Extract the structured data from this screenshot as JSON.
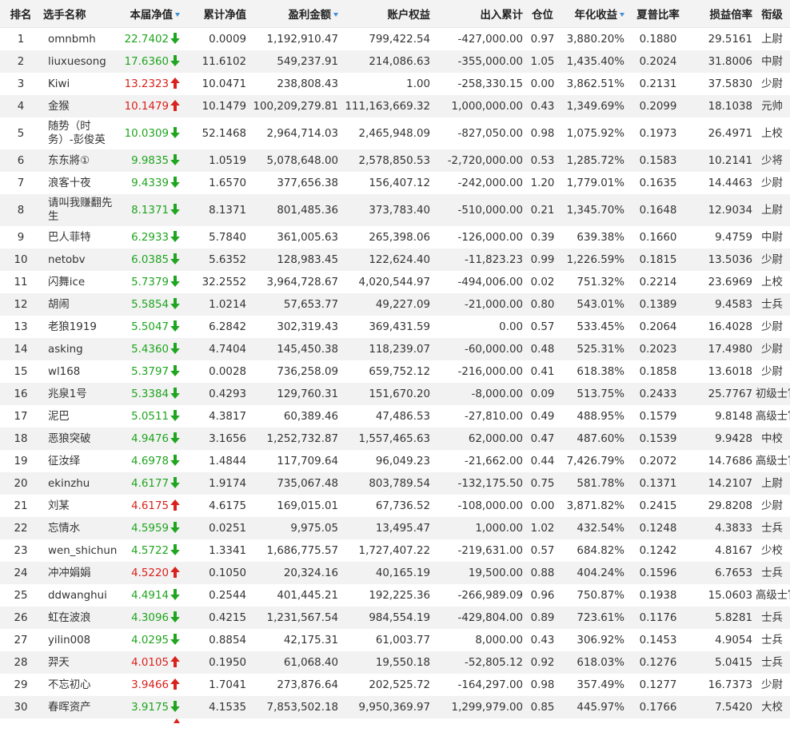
{
  "columns": {
    "rank": "排名",
    "name": "选手名称",
    "week_nav": "本届净值",
    "cum_nav": "累计净值",
    "profit": "盈利金额",
    "equity": "账户权益",
    "inout": "出入累计",
    "position": "仓位",
    "annual": "年化收益",
    "sharpe": "夏普比率",
    "pl_ratio": "损益倍率",
    "title": "衔级"
  },
  "colors": {
    "up": "#d9221c",
    "down": "#1fa51f",
    "sort_indicator": "#3d8fd6",
    "alt_row": "#f2f2f2"
  },
  "rows": [
    {
      "rank": "1",
      "name": "omnbmh",
      "nav": "22.7402",
      "trend": "down",
      "cum": "0.0009",
      "profit": "1,192,910.47",
      "equity": "799,422.54",
      "inout": "-427,000.00",
      "pos": "0.97",
      "annual": "3,880.20%",
      "sharpe": "0.1880",
      "pl": "29.5161",
      "title": "上尉"
    },
    {
      "rank": "2",
      "name": "liuxuesong",
      "nav": "17.6360",
      "trend": "down",
      "cum": "11.6102",
      "profit": "549,237.91",
      "equity": "214,086.63",
      "inout": "-355,000.00",
      "pos": "1.05",
      "annual": "1,435.40%",
      "sharpe": "0.2024",
      "pl": "31.8006",
      "title": "中尉"
    },
    {
      "rank": "3",
      "name": "Kiwi",
      "nav": "13.2323",
      "trend": "up",
      "cum": "10.0471",
      "profit": "238,808.43",
      "equity": "1.00",
      "inout": "-258,330.15",
      "pos": "0.00",
      "annual": "3,862.51%",
      "sharpe": "0.2131",
      "pl": "37.5830",
      "title": "少尉"
    },
    {
      "rank": "4",
      "name": "金猴",
      "nav": "10.1479",
      "trend": "up",
      "cum": "10.1479",
      "profit": "100,209,279.81",
      "equity": "111,163,669.32",
      "inout": "1,000,000.00",
      "pos": "0.43",
      "annual": "1,349.69%",
      "sharpe": "0.2099",
      "pl": "18.1038",
      "title": "元帅"
    },
    {
      "rank": "5",
      "name": "随势（时务）-彭俊英",
      "nav": "10.0309",
      "trend": "down",
      "cum": "52.1468",
      "profit": "2,964,714.03",
      "equity": "2,465,948.09",
      "inout": "-827,050.00",
      "pos": "0.98",
      "annual": "1,075.92%",
      "sharpe": "0.1973",
      "pl": "26.4971",
      "title": "上校",
      "tall": true
    },
    {
      "rank": "6",
      "name": "东东將①",
      "nav": "9.9835",
      "trend": "down",
      "cum": "1.0519",
      "profit": "5,078,648.00",
      "equity": "2,578,850.53",
      "inout": "-2,720,000.00",
      "pos": "0.53",
      "annual": "1,285.72%",
      "sharpe": "0.1583",
      "pl": "10.2141",
      "title": "少将"
    },
    {
      "rank": "7",
      "name": "浪客十夜",
      "nav": "9.4339",
      "trend": "down",
      "cum": "1.6570",
      "profit": "377,656.38",
      "equity": "156,407.12",
      "inout": "-242,000.00",
      "pos": "1.20",
      "annual": "1,779.01%",
      "sharpe": "0.1635",
      "pl": "14.4463",
      "title": "少尉"
    },
    {
      "rank": "8",
      "name": "请叫我赚翻先生",
      "nav": "8.1371",
      "trend": "down",
      "cum": "8.1371",
      "profit": "801,485.36",
      "equity": "373,783.40",
      "inout": "-510,000.00",
      "pos": "0.21",
      "annual": "1,345.70%",
      "sharpe": "0.1648",
      "pl": "12.9034",
      "title": "上尉",
      "tall": true
    },
    {
      "rank": "9",
      "name": "巴人菲特",
      "nav": "6.2933",
      "trend": "down",
      "cum": "5.7840",
      "profit": "361,005.63",
      "equity": "265,398.06",
      "inout": "-126,000.00",
      "pos": "0.39",
      "annual": "639.38%",
      "sharpe": "0.1660",
      "pl": "9.4759",
      "title": "中尉"
    },
    {
      "rank": "10",
      "name": "netobv",
      "nav": "6.0385",
      "trend": "down",
      "cum": "5.6352",
      "profit": "128,983.45",
      "equity": "122,624.40",
      "inout": "-11,823.23",
      "pos": "0.99",
      "annual": "1,226.59%",
      "sharpe": "0.1815",
      "pl": "13.5036",
      "title": "少尉"
    },
    {
      "rank": "11",
      "name": "闪舞ice",
      "nav": "5.7379",
      "trend": "down",
      "cum": "32.2552",
      "profit": "3,964,728.67",
      "equity": "4,020,544.97",
      "inout": "-494,006.00",
      "pos": "0.02",
      "annual": "751.32%",
      "sharpe": "0.2214",
      "pl": "23.6969",
      "title": "上校"
    },
    {
      "rank": "12",
      "name": "胡闹",
      "nav": "5.5854",
      "trend": "down",
      "cum": "1.0214",
      "profit": "57,653.77",
      "equity": "49,227.09",
      "inout": "-21,000.00",
      "pos": "0.80",
      "annual": "543.01%",
      "sharpe": "0.1389",
      "pl": "9.4583",
      "title": "士兵"
    },
    {
      "rank": "13",
      "name": "老狼1919",
      "nav": "5.5047",
      "trend": "down",
      "cum": "6.2842",
      "profit": "302,319.43",
      "equity": "369,431.59",
      "inout": "0.00",
      "pos": "0.57",
      "annual": "533.45%",
      "sharpe": "0.2064",
      "pl": "16.4028",
      "title": "少尉"
    },
    {
      "rank": "14",
      "name": "asking",
      "nav": "5.4360",
      "trend": "down",
      "cum": "4.7404",
      "profit": "145,450.38",
      "equity": "118,239.07",
      "inout": "-60,000.00",
      "pos": "0.48",
      "annual": "525.31%",
      "sharpe": "0.2023",
      "pl": "17.4980",
      "title": "少尉"
    },
    {
      "rank": "15",
      "name": "wl168",
      "nav": "5.3797",
      "trend": "down",
      "cum": "0.0028",
      "profit": "736,258.09",
      "equity": "659,752.12",
      "inout": "-216,000.00",
      "pos": "0.41",
      "annual": "618.38%",
      "sharpe": "0.1858",
      "pl": "13.6018",
      "title": "少尉"
    },
    {
      "rank": "16",
      "name": "兆泉1号",
      "nav": "5.3384",
      "trend": "down",
      "cum": "0.4293",
      "profit": "129,760.31",
      "equity": "151,670.20",
      "inout": "-8,000.00",
      "pos": "0.09",
      "annual": "513.75%",
      "sharpe": "0.2433",
      "pl": "25.7767",
      "title": "初级士官"
    },
    {
      "rank": "17",
      "name": "泥巴",
      "nav": "5.0511",
      "trend": "down",
      "cum": "4.3817",
      "profit": "60,389.46",
      "equity": "47,486.53",
      "inout": "-27,810.00",
      "pos": "0.49",
      "annual": "488.95%",
      "sharpe": "0.1579",
      "pl": "9.8148",
      "title": "高级士官"
    },
    {
      "rank": "18",
      "name": "恶狼突破",
      "nav": "4.9476",
      "trend": "down",
      "cum": "3.1656",
      "profit": "1,252,732.87",
      "equity": "1,557,465.63",
      "inout": "62,000.00",
      "pos": "0.47",
      "annual": "487.60%",
      "sharpe": "0.1539",
      "pl": "9.9428",
      "title": "中校"
    },
    {
      "rank": "19",
      "name": "征汝绎",
      "nav": "4.6978",
      "trend": "down",
      "cum": "1.4844",
      "profit": "117,709.64",
      "equity": "96,049.23",
      "inout": "-21,662.00",
      "pos": "0.44",
      "annual": "7,426.79%",
      "sharpe": "0.2072",
      "pl": "14.7686",
      "title": "高级士官"
    },
    {
      "rank": "20",
      "name": "ekinzhu",
      "nav": "4.6177",
      "trend": "down",
      "cum": "1.9174",
      "profit": "735,067.48",
      "equity": "803,789.54",
      "inout": "-132,175.50",
      "pos": "0.75",
      "annual": "581.78%",
      "sharpe": "0.1371",
      "pl": "14.2107",
      "title": "上尉"
    },
    {
      "rank": "21",
      "name": "刘某",
      "nav": "4.6175",
      "trend": "up",
      "cum": "4.6175",
      "profit": "169,015.01",
      "equity": "67,736.52",
      "inout": "-108,000.00",
      "pos": "0.00",
      "annual": "3,871.82%",
      "sharpe": "0.2415",
      "pl": "29.8208",
      "title": "少尉"
    },
    {
      "rank": "22",
      "name": "忘情水",
      "nav": "4.5959",
      "trend": "down",
      "cum": "0.0251",
      "profit": "9,975.05",
      "equity": "13,495.47",
      "inout": "1,000.00",
      "pos": "1.02",
      "annual": "432.54%",
      "sharpe": "0.1248",
      "pl": "4.3833",
      "title": "士兵"
    },
    {
      "rank": "23",
      "name": "wen_shichun",
      "nav": "4.5722",
      "trend": "down",
      "cum": "1.3341",
      "profit": "1,686,775.57",
      "equity": "1,727,407.22",
      "inout": "-219,631.00",
      "pos": "0.57",
      "annual": "684.82%",
      "sharpe": "0.1242",
      "pl": "4.8167",
      "title": "少校"
    },
    {
      "rank": "24",
      "name": "冲冲娟娟",
      "nav": "4.5220",
      "trend": "up",
      "cum": "0.1050",
      "profit": "20,324.16",
      "equity": "40,165.19",
      "inout": "19,500.00",
      "pos": "0.88",
      "annual": "404.24%",
      "sharpe": "0.1596",
      "pl": "6.7653",
      "title": "士兵"
    },
    {
      "rank": "25",
      "name": "ddwanghui",
      "nav": "4.4914",
      "trend": "down",
      "cum": "0.2544",
      "profit": "401,445.21",
      "equity": "192,225.36",
      "inout": "-266,989.09",
      "pos": "0.96",
      "annual": "750.87%",
      "sharpe": "0.1938",
      "pl": "15.0603",
      "title": "高级士官"
    },
    {
      "rank": "26",
      "name": "虹在波浪",
      "nav": "4.3096",
      "trend": "down",
      "cum": "0.4215",
      "profit": "1,231,567.54",
      "equity": "984,554.19",
      "inout": "-429,804.00",
      "pos": "0.89",
      "annual": "723.61%",
      "sharpe": "0.1176",
      "pl": "5.8281",
      "title": "士兵"
    },
    {
      "rank": "27",
      "name": "yilin008",
      "nav": "4.0295",
      "trend": "down",
      "cum": "0.8854",
      "profit": "42,175.31",
      "equity": "61,003.77",
      "inout": "8,000.00",
      "pos": "0.43",
      "annual": "306.92%",
      "sharpe": "0.1453",
      "pl": "4.9054",
      "title": "士兵"
    },
    {
      "rank": "28",
      "name": "羿天",
      "nav": "4.0105",
      "trend": "up",
      "cum": "0.1950",
      "profit": "61,068.40",
      "equity": "19,550.18",
      "inout": "-52,805.12",
      "pos": "0.92",
      "annual": "618.03%",
      "sharpe": "0.1276",
      "pl": "5.0415",
      "title": "士兵"
    },
    {
      "rank": "29",
      "name": "不忘初心",
      "nav": "3.9466",
      "trend": "up",
      "cum": "1.7041",
      "profit": "273,876.64",
      "equity": "202,525.72",
      "inout": "-164,297.00",
      "pos": "0.98",
      "annual": "357.49%",
      "sharpe": "0.1277",
      "pl": "16.7373",
      "title": "少尉"
    },
    {
      "rank": "30",
      "name": "春晖资产",
      "nav": "3.9175",
      "trend": "down",
      "cum": "4.1535",
      "profit": "7,853,502.18",
      "equity": "9,950,369.97",
      "inout": "1,299,979.00",
      "pos": "0.85",
      "annual": "445.97%",
      "sharpe": "0.1766",
      "pl": "7.5420",
      "title": "大校"
    }
  ]
}
